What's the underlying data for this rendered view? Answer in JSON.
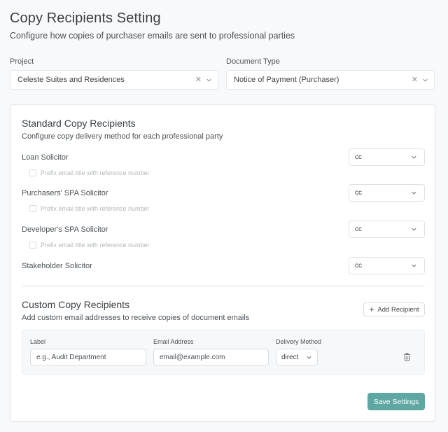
{
  "page": {
    "title": "Copy Recipients Setting",
    "subtitle": "Configure how copies of purchaser emails are sent to professional parties"
  },
  "filters": {
    "project_label": "Project",
    "project_value": "Celeste Suites and Residences",
    "doctype_label": "Document Type",
    "doctype_value": "Notice of Payment (Purchaser)"
  },
  "standard": {
    "title": "Standard Copy Recipients",
    "subtitle": "Configure copy delivery method for each professional party",
    "prefix_label": "Prefix email title with reference number",
    "parties": [
      {
        "label": "Loan Solicitor",
        "method": "cc",
        "has_prefix": true
      },
      {
        "label": "Purchasers' SPA Solicitor",
        "method": "cc",
        "has_prefix": true
      },
      {
        "label": "Developer's SPA Solicitor",
        "method": "cc",
        "has_prefix": true
      },
      {
        "label": "Stakeholder Solicitor",
        "method": "cc",
        "has_prefix": false
      }
    ]
  },
  "custom": {
    "title": "Custom Copy Recipients",
    "subtitle": "Add custom email addresses to receive copies of document emails",
    "add_button": "Add Recipient",
    "row": {
      "label_header": "Label",
      "label_placeholder": "e.g., Audit Department",
      "email_header": "Email Address",
      "email_placeholder": "email@example.com",
      "method_header": "Delivery Method",
      "method_value": "direct"
    }
  },
  "actions": {
    "save_label": "Save Settings"
  },
  "colors": {
    "primary": "#5fa7a2",
    "background": "#f8f9fa"
  },
  "icons": {
    "clear": "x-icon",
    "dropdown": "chevron-down-icon",
    "add": "plus-icon",
    "delete": "trash-icon"
  }
}
